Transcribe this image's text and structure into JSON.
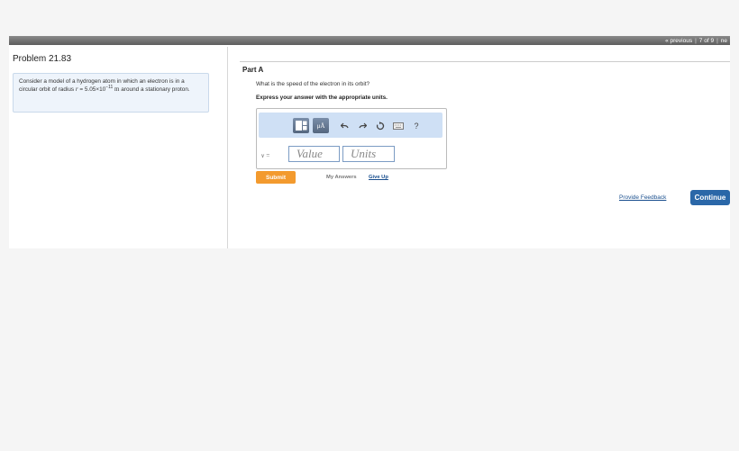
{
  "nav": {
    "previous_label": "« previous",
    "position": "7 of 9",
    "next_label": "ne"
  },
  "problem": {
    "title": "Problem 21.83",
    "desc_part1": "Consider a model of a hydrogen atom in which an electron is in a circular orbit of radius ",
    "radius_symbol": "r",
    "radius_equals": " = 5.05×10",
    "radius_exponent": "−11",
    "radius_unit": " m",
    "desc_part2": " around a stationary proton."
  },
  "part": {
    "title": "Part A",
    "question": "What is the speed of the electron in its orbit?",
    "instruction": "Express your answer with the appropriate units."
  },
  "toolbar": {
    "icons": [
      "templates-icon",
      "units-icon",
      "undo-icon",
      "redo-icon",
      "reset-icon",
      "keyboard-icon",
      "help-icon"
    ],
    "units_glyph": "μÅ",
    "help_glyph": "?"
  },
  "answer": {
    "variable_label": "v =",
    "value_placeholder": "Value",
    "units_placeholder": "Units"
  },
  "actions": {
    "submit_label": "Submit",
    "my_answers_label": "My Answers",
    "give_up_label": "Give Up",
    "feedback_label": "Provide Feedback",
    "continue_label": "Continue"
  },
  "colors": {
    "submit": "#f39a2e",
    "continue": "#2a67a8",
    "link": "#1a4f8e",
    "toolbar": "#cfe0f5"
  }
}
